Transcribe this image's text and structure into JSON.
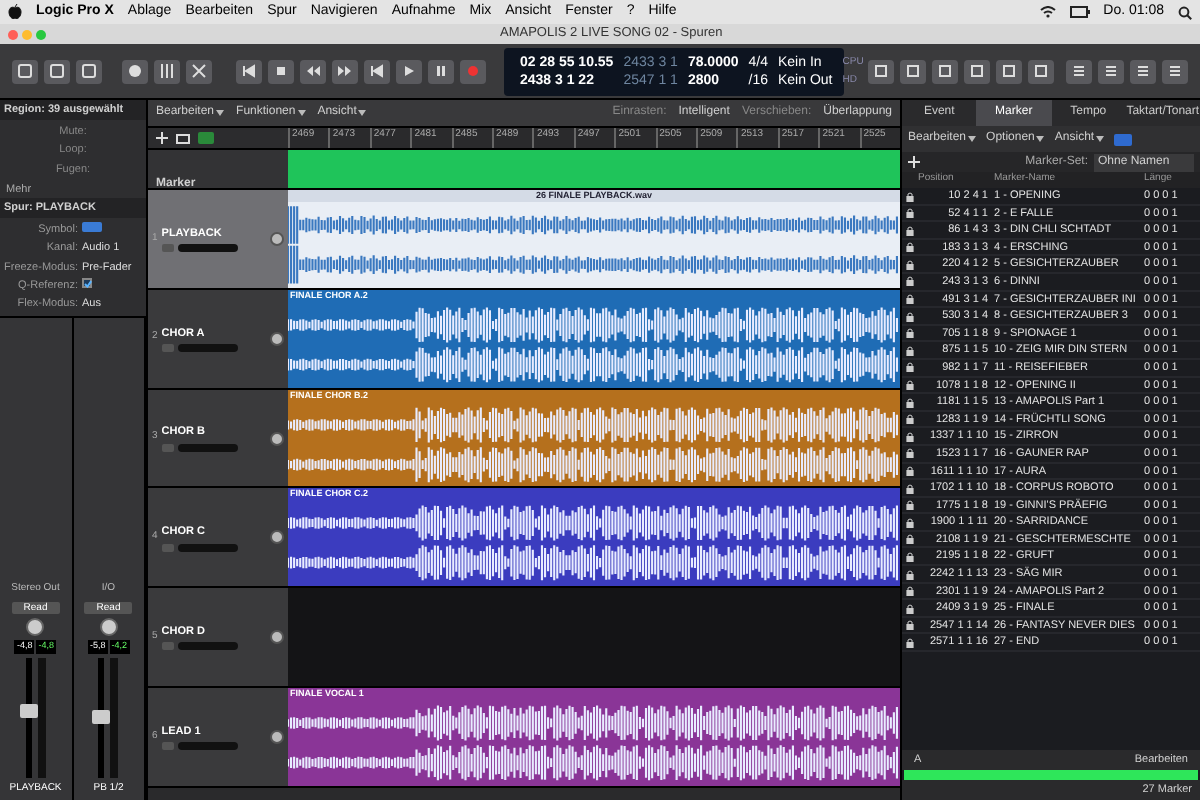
{
  "menu_bar": {
    "app": "Logic Pro X",
    "items": [
      "Ablage",
      "Bearbeiten",
      "Spur",
      "Navigieren",
      "Aufnahme",
      "Mix",
      "Ansicht",
      "Fenster",
      "?",
      "Hilfe"
    ],
    "clock": "Do. 01:08"
  },
  "window": {
    "title": "AMAPOLIS 2 LIVE SONG 02 - Spuren"
  },
  "lcd": {
    "line_1": [
      "02 28 55 10.55",
      "2433 3 1",
      "78.0000",
      "4/4",
      "Kein In",
      "CPU"
    ],
    "line_2": [
      "2438 3 1 22",
      "2547 1 1",
      "2800",
      "/16",
      "Kein Out",
      "HD"
    ]
  },
  "inspector": {
    "region_header": "Region: 39 ausgewählt",
    "region_fields": [
      "Mute:",
      "Loop:",
      "Fugen:"
    ],
    "more": "Mehr",
    "track_header": "Spur: PLAYBACK",
    "track_fields": [
      {
        "kind": "button",
        "label": "Symbol:"
      },
      {
        "kind": "text",
        "label": "Kanal:",
        "value": "Audio 1"
      },
      {
        "kind": "text",
        "label": "Freeze-Modus:",
        "value": "Pre-Fader"
      },
      {
        "kind": "checkbox",
        "label": "Q-Referenz:",
        "checked": true
      },
      {
        "kind": "text",
        "label": "Flex-Modus:",
        "value": "Aus"
      }
    ],
    "channel_strips": [
      {
        "output": "Stereo Out",
        "automation": "Read",
        "readouts": [
          "-4,8",
          "-4,8"
        ],
        "name": "PLAYBACK",
        "level": 0.55
      },
      {
        "output": "I/O",
        "automation": "Read",
        "readouts": [
          "-5,8",
          "-4,2"
        ],
        "name": "PB 1/2",
        "level": 0.5
      }
    ]
  },
  "tracks_toolbar": {
    "menus": [
      "Bearbeiten",
      "Funktionen",
      "Ansicht"
    ],
    "snap_label": "Einrasten:",
    "snap_value": "Intelligent",
    "drag_label": "Verschieben:",
    "drag_value": "Überlappung"
  },
  "ruler": [
    "2469",
    "2473",
    "2477",
    "2481",
    "2485",
    "2489",
    "2493",
    "2497",
    "2501",
    "2505",
    "2509",
    "2513",
    "2517",
    "2521",
    "2525"
  ],
  "marker_track": {
    "name": "Marker"
  },
  "tracks": [
    {
      "number": "1",
      "name": "PLAYBACK",
      "selected": true,
      "region": {
        "kind": "full",
        "name": "26 FINALE PLAYBACK.wav",
        "color": "#e9eef5"
      }
    },
    {
      "number": "2",
      "name": "CHOR A",
      "selected": false,
      "region": {
        "kind": "bursts",
        "name": "FINALE CHOR A.2",
        "color": "#1f6cb5"
      }
    },
    {
      "number": "3",
      "name": "CHOR B",
      "selected": false,
      "region": {
        "kind": "bursts",
        "name": "FINALE CHOR B.2",
        "color": "#b5701d"
      }
    },
    {
      "number": "4",
      "name": "CHOR C",
      "selected": false,
      "region": {
        "kind": "bursts",
        "name": "FINALE CHOR C.2",
        "color": "#3b3cbf"
      }
    },
    {
      "number": "5",
      "name": "CHOR D",
      "selected": false
    },
    {
      "number": "6",
      "name": "LEAD 1",
      "selected": false,
      "region": {
        "kind": "bursts",
        "name": "FINALE VOCAL 1",
        "color": "#8a3597"
      }
    }
  ],
  "marker_panel": {
    "tabs": [
      {
        "label": "Event",
        "selected": false
      },
      {
        "label": "Marker",
        "selected": true
      },
      {
        "label": "Tempo",
        "selected": false
      },
      {
        "label": "Taktart/Tonart",
        "selected": false
      }
    ],
    "menus": [
      "Bearbeiten",
      "Optionen",
      "Ansicht"
    ],
    "set_label": "Marker-Set:",
    "set_value": "Ohne Namen",
    "columns": [
      "Position",
      "Marker-Name",
      "Länge"
    ],
    "rows": [
      {
        "position": "10 2 4 1",
        "name": "1 - OPENING",
        "length": "0 0 0 1"
      },
      {
        "position": "52 4 1 1",
        "name": "2 - E FALLE",
        "length": "0 0 0 1"
      },
      {
        "position": "86 1 4 3",
        "name": "3 - DIN CHLI SCHTADT",
        "length": "0 0 0 1"
      },
      {
        "position": "183 3 1 3",
        "name": "4 - ERSCHING",
        "length": "0 0 0 1"
      },
      {
        "position": "220 4 1 2",
        "name": "5 - GESICHTERZAUBER",
        "length": "0 0 0 1"
      },
      {
        "position": "243 3 1 3",
        "name": "6 - DINNI",
        "length": "0 0 0 1"
      },
      {
        "position": "491 3 1 4",
        "name": "7 - GESICHTERZAUBER INI",
        "length": "0 0 0 1"
      },
      {
        "position": "530 3 1 4",
        "name": "8 - GESICHTERZAUBER 3",
        "length": "0 0 0 1"
      },
      {
        "position": "705 1 1 8",
        "name": "9 - SPIONAGE 1",
        "length": "0 0 0 1"
      },
      {
        "position": "875 1 1 5",
        "name": "10 - ZEIG MIR DIN STERN",
        "length": "0 0 0 1"
      },
      {
        "position": "982 1 1 7",
        "name": "11 - REISEFIEBER",
        "length": "0 0 0 1"
      },
      {
        "position": "1078 1 1 8",
        "name": "12 - OPENING II",
        "length": "0 0 0 1"
      },
      {
        "position": "1181 1 1 5",
        "name": "13 - AMAPOLIS Part 1",
        "length": "0 0 0 1"
      },
      {
        "position": "1283 1 1 9",
        "name": "14 - FRÜCHTLI SONG",
        "length": "0 0 0 1"
      },
      {
        "position": "1337 1 1 10",
        "name": "15 - ZIRRON",
        "length": "0 0 0 1"
      },
      {
        "position": "1523 1 1 7",
        "name": "16 - GAUNER RAP",
        "length": "0 0 0 1"
      },
      {
        "position": "1611 1 1 10",
        "name": "17 - AURA",
        "length": "0 0 0 1"
      },
      {
        "position": "1702 1 1 10",
        "name": "18 - CORPUS ROBOTO",
        "length": "0 0 0 1"
      },
      {
        "position": "1775 1 1 8",
        "name": "19 - GINNI'S PRÄEFIG",
        "length": "0 0 0 1"
      },
      {
        "position": "1900 1 1 11",
        "name": "20 - SARRIDANCE",
        "length": "0 0 0 1"
      },
      {
        "position": "2108 1 1 9",
        "name": "21 - GESCHTERMESCHTE",
        "length": "0 0 0 1"
      },
      {
        "position": "2195 1 1 8",
        "name": "22 - GRUFT",
        "length": "0 0 0 1"
      },
      {
        "position": "2242 1 1 13",
        "name": "23 - SÄG MIR",
        "length": "0 0 0 1"
      },
      {
        "position": "2301 1 1 9",
        "name": "24 - AMAPOLIS Part 2",
        "length": "0 0 0 1"
      },
      {
        "position": "2409 3 1 9",
        "name": "25 - FINALE",
        "length": "0 0 0 1"
      },
      {
        "position": "2547 1 1 14",
        "name": "26 - FANTASY NEVER DIES",
        "length": "0 0 0 1"
      },
      {
        "position": "2571 1 1 16",
        "name": "27 - END",
        "length": "0 0 0 1"
      }
    ],
    "footer_left": "A",
    "footer_right": "Bearbeiten",
    "count": "27 Marker"
  }
}
